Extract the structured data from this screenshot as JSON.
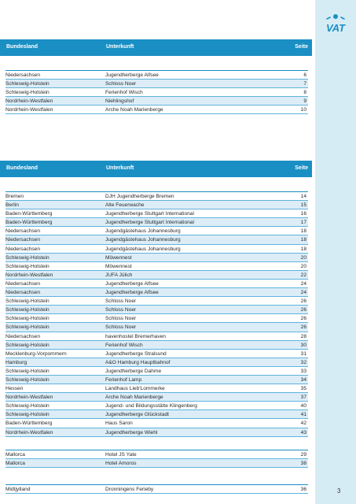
{
  "brand": {
    "logo_text": "VAT"
  },
  "page_number": "3",
  "table1": {
    "headers": [
      "Bundesland",
      "Unterkunft",
      "Seite"
    ],
    "rows": [
      [
        "Niedersachsen",
        "Jugendherberge Alfsee",
        "6"
      ],
      [
        "Schleswig-Holstein",
        "Schloss Noer",
        "7"
      ],
      [
        "Schleswig-Holstein",
        "Ferienhof Wisch",
        "8"
      ],
      [
        "Nordrhein-Westfalen",
        "Niehlingshof",
        "9"
      ],
      [
        "Nordrhein-Westfalen",
        "Arche Noah Marienberge",
        "10"
      ]
    ]
  },
  "table2": {
    "headers": [
      "Bundesland",
      "Unterkunft",
      "Seite"
    ],
    "rows": [
      [
        "Bremen",
        "DJH Jugendherberge Bremen",
        "14"
      ],
      [
        "Berlin",
        "Alte Feuerwache",
        "15"
      ],
      [
        "Baden-Württemberg",
        "Jugendherberge Stuttgart International",
        "16"
      ],
      [
        "Baden-Württemberg",
        "Jugendherberge Stuttgart International",
        "17"
      ],
      [
        "Niedersachsen",
        "Jugendgästehaus Johannesburg",
        "18"
      ],
      [
        "Niedersachsen",
        "Jugendgästehaus Johannesburg",
        "18"
      ],
      [
        "Niedersachsen",
        "Jugendgästehaus Johannesburg",
        "18"
      ],
      [
        "Schleswig-Holstein",
        "Möwennest",
        "20"
      ],
      [
        "Schleswig-Holstein",
        "Möwennest",
        "20"
      ],
      [
        "Nordrhein-Westfalen",
        "JUFA Jülich",
        "22"
      ],
      [
        "Niedersachsen",
        "Jugendherberge Alfsee",
        "24"
      ],
      [
        "Niedersachsen",
        "Jugendherberge Alfsee",
        "24"
      ],
      [
        "Schleswig-Holstein",
        "Schloss Noer",
        "26"
      ],
      [
        "Schleswig-Holstein",
        "Schloss Noer",
        "26"
      ],
      [
        "Schleswig-Holstein",
        "Schloss Noer",
        "26"
      ],
      [
        "Schleswig-Holstein",
        "Schloss Noer",
        "26"
      ],
      [
        "Niedersachsen",
        "havenhostel Bremerhaven",
        "28"
      ],
      [
        "Schleswig-Holstein",
        "Ferienhof Wisch",
        "30"
      ],
      [
        "Mecklenburg-Vorpommern",
        "Jugendherberge Stralsund",
        "31"
      ],
      [
        "Hamburg",
        "A&O Hamburg Hauptbahnof",
        "32"
      ],
      [
        "Schleswig-Holstein",
        "Jugendherberge Dahme",
        "33"
      ],
      [
        "Schleswig-Holstein",
        "Ferienhof Lamp",
        "34"
      ],
      [
        "Hessen",
        "Landhaus Lieb'Lommerke",
        "35"
      ],
      [
        "Nordrhein-Westfalen",
        "Arche Noah Marienberge",
        "37"
      ],
      [
        "Schleswig-Holstein",
        "Jugend- und Bildungsstätte Klingenberg",
        "40"
      ],
      [
        "Schleswig-Holstein",
        "Jugendherberge Glückstadt",
        "41"
      ],
      [
        "Baden-Württemberg",
        "Haus Saron",
        "42"
      ],
      [
        "Nordrhein-Westfalen",
        "Jugendherberge Wiehl",
        "43"
      ]
    ]
  },
  "table3": {
    "rows": [
      [
        "Mallorca",
        "Hotel JS Yate",
        "29"
      ],
      [
        "Mallorca",
        "Hotel Amoros",
        "38"
      ]
    ]
  },
  "table4": {
    "rows": [
      [
        "Midtjytland",
        "Dronningens Ferieby",
        "36"
      ]
    ]
  },
  "colors": {
    "header_blue": "#1a8fc4",
    "row_shade": "#dcedf7",
    "side_bar": "#d6ecf5",
    "rule": "#5fb3dc"
  }
}
